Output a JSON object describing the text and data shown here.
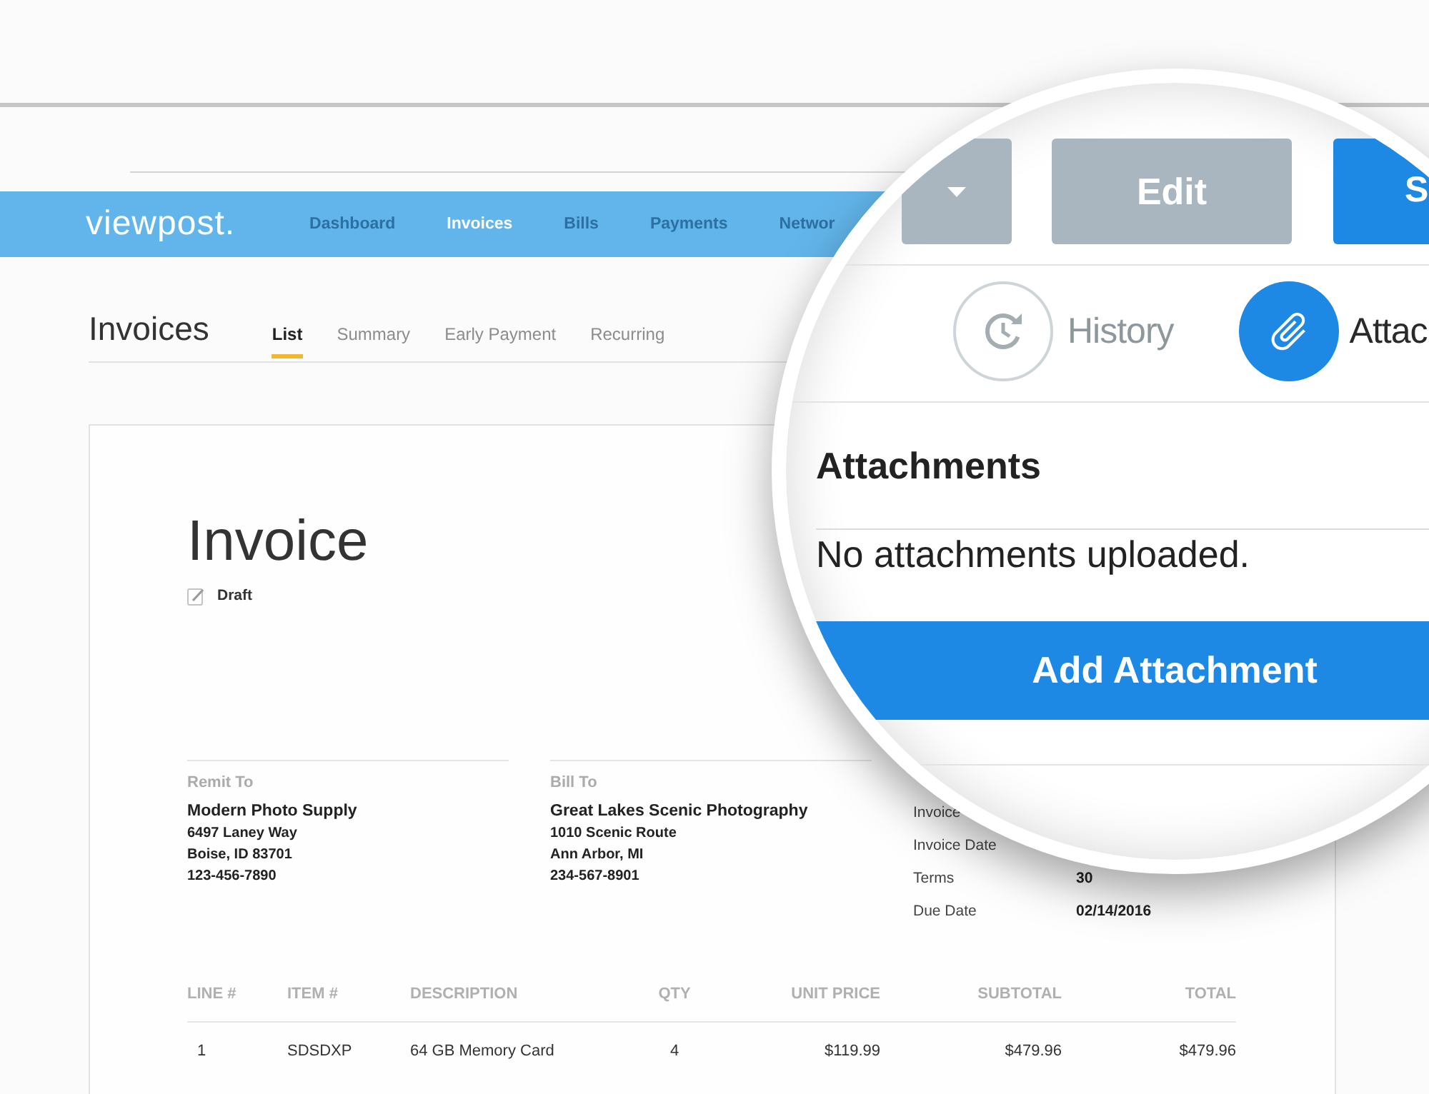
{
  "navbar": {
    "logo": "viewpost.",
    "items": [
      {
        "label": "Dashboard",
        "selected": false
      },
      {
        "label": "Invoices",
        "selected": true
      },
      {
        "label": "Bills",
        "selected": false
      },
      {
        "label": "Payments",
        "selected": false
      },
      {
        "label": "Networ",
        "selected": false
      }
    ]
  },
  "page": {
    "title": "Invoices",
    "tabs": [
      {
        "label": "List",
        "selected": true
      },
      {
        "label": "Summary",
        "selected": false
      },
      {
        "label": "Early Payment",
        "selected": false
      },
      {
        "label": "Recurring",
        "selected": false
      }
    ]
  },
  "invoice": {
    "title": "Invoice",
    "status": "Draft",
    "parties": [
      {
        "heading": "Remit To",
        "name": "Modern Photo Supply",
        "address": [
          "6497 Laney Way",
          "Boise, ID 83701"
        ],
        "phone": "123-456-7890"
      },
      {
        "heading": "Bill To",
        "name": "Great Lakes Scenic Photography",
        "address": [
          "1010 Scenic Route",
          "Ann Arbor, MI"
        ],
        "phone": "234-567-8901"
      }
    ],
    "details": [
      {
        "label": "Invoice"
      },
      {
        "label": "Invoice Date"
      },
      {
        "label": "Terms",
        "value": "30"
      },
      {
        "label": "Due Date",
        "value": "02/14/2016"
      }
    ],
    "table": {
      "columns": [
        "LINE #",
        "ITEM #",
        "DESCRIPTION",
        "QTY",
        "UNIT PRICE",
        "SUBTOTAL",
        "TOTAL"
      ],
      "rows": [
        [
          "1",
          "SDSDXP",
          "64 GB Memory Card",
          "4",
          "$119.99",
          "$479.96",
          "$479.96"
        ]
      ]
    }
  },
  "magnifier": {
    "buttons": [
      {
        "kind": "menu"
      },
      {
        "kind": "secondary",
        "label": "Edit"
      },
      {
        "kind": "primary",
        "label": "S"
      }
    ],
    "tabs": [
      {
        "kind": "history",
        "label": "History",
        "selected": false
      },
      {
        "kind": "attachments",
        "label": "Attac",
        "selected": true
      }
    ],
    "section": {
      "heading": "Attachments",
      "empty_text": "No attachments uploaded.",
      "action": "Add Attachment"
    }
  }
}
